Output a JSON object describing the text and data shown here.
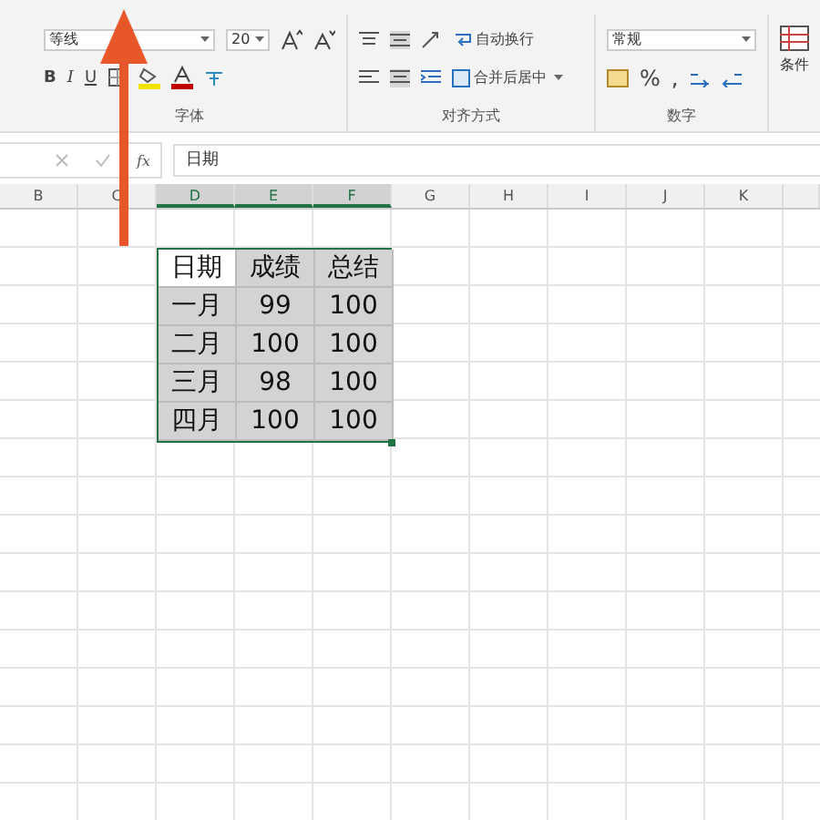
{
  "font_group": {
    "font_name": "等线",
    "font_size": "20",
    "bold": "B",
    "italic": "I",
    "underline": "U",
    "label": "字体"
  },
  "alignment_group": {
    "wrap_text": "自动换行",
    "merge_center": "合并后居中",
    "label": "对齐方式"
  },
  "number_group": {
    "format": "常规",
    "percent": "%",
    "comma": ",",
    "label": "数字"
  },
  "styles_group": {
    "conditional": "条件"
  },
  "formula_bar": {
    "fx": "fx",
    "formula": "日期"
  },
  "column_headers": [
    {
      "label": "B",
      "selected": false
    },
    {
      "label": "C",
      "selected": false
    },
    {
      "label": "D",
      "selected": true
    },
    {
      "label": "E",
      "selected": true
    },
    {
      "label": "F",
      "selected": true
    },
    {
      "label": "G",
      "selected": false
    },
    {
      "label": "H",
      "selected": false
    },
    {
      "label": "I",
      "selected": false
    },
    {
      "label": "J",
      "selected": false
    },
    {
      "label": "K",
      "selected": false
    }
  ],
  "table": {
    "rows": [
      [
        {
          "text": "日期",
          "active": true
        },
        {
          "text": "成绩",
          "active": false
        },
        {
          "text": "总结",
          "active": false
        }
      ],
      [
        {
          "text": "一月",
          "active": false
        },
        {
          "text": "99",
          "active": false
        },
        {
          "text": "100",
          "active": false
        }
      ],
      [
        {
          "text": "二月",
          "active": false
        },
        {
          "text": "100",
          "active": false
        },
        {
          "text": "100",
          "active": false
        }
      ],
      [
        {
          "text": "三月",
          "active": false
        },
        {
          "text": "98",
          "active": false
        },
        {
          "text": "100",
          "active": false
        }
      ],
      [
        {
          "text": "四月",
          "active": false
        },
        {
          "text": "100",
          "active": false
        },
        {
          "text": "100",
          "active": false
        }
      ]
    ]
  }
}
